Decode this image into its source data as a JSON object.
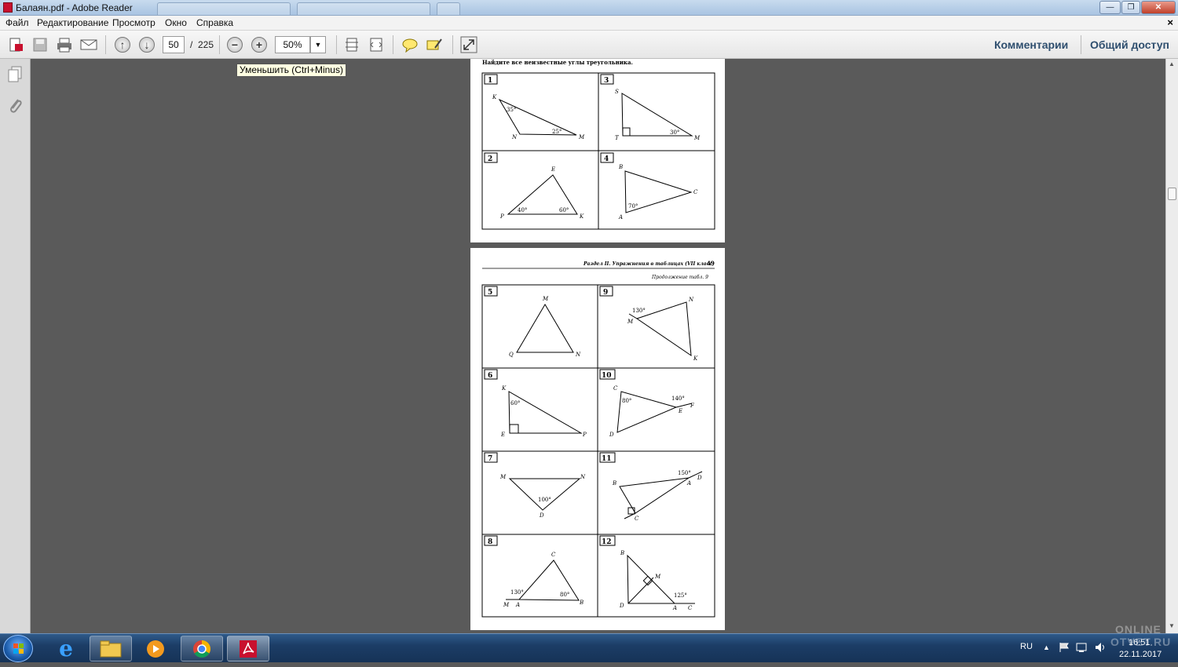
{
  "window": {
    "title": "Балаян.pdf - Adobe Reader",
    "minimize": "—",
    "maximize": "❐",
    "close": "✕"
  },
  "menu": {
    "items": [
      "Файл",
      "Редактирование",
      "Просмотр",
      "Окно",
      "Справка"
    ],
    "close": "×"
  },
  "toolbar": {
    "page_current": "50",
    "page_separator": "/",
    "page_total": "225",
    "zoom": "50%",
    "comments_label": "Комментарии",
    "share_label": "Общий доступ"
  },
  "tooltip": "Уменьшить (Ctrl+Minus)",
  "document": {
    "page1": {
      "header": "Найдите все неизвестные углы треугольника.",
      "cells": [
        {
          "num": "1",
          "labels": [
            "K",
            "N",
            "M",
            "35°",
            "25°"
          ]
        },
        {
          "num": "3",
          "labels": [
            "S",
            "T",
            "M",
            "30°"
          ]
        },
        {
          "num": "2",
          "labels": [
            "E",
            "P",
            "K",
            "40°",
            "60°"
          ]
        },
        {
          "num": "4",
          "labels": [
            "B",
            "C",
            "A",
            "70°"
          ]
        }
      ]
    },
    "page2": {
      "running_head": "Раздел II. Упражнения в таблицах (VII класс)",
      "page_number": "49",
      "continuation": "Продолжение табл. 9",
      "cells": [
        {
          "num": "5",
          "labels": [
            "M",
            "Q",
            "N"
          ]
        },
        {
          "num": "9",
          "labels": [
            "N",
            "M",
            "K",
            "130°"
          ]
        },
        {
          "num": "6",
          "labels": [
            "K",
            "E",
            "P",
            "60°"
          ]
        },
        {
          "num": "10",
          "labels": [
            "C",
            "D",
            "E",
            "F",
            "80°",
            "140°"
          ]
        },
        {
          "num": "7",
          "labels": [
            "M",
            "N",
            "D",
            "100°"
          ]
        },
        {
          "num": "11",
          "labels": [
            "B",
            "A",
            "D",
            "C",
            "150°"
          ]
        },
        {
          "num": "8",
          "labels": [
            "C",
            "M",
            "A",
            "B",
            "130°",
            "80°"
          ]
        },
        {
          "num": "12",
          "labels": [
            "B",
            "M",
            "D",
            "A",
            "C",
            "125°"
          ]
        }
      ]
    }
  },
  "taskbar": {
    "apps": [
      "internet-explorer",
      "file-explorer",
      "media-player",
      "chrome",
      "adobe-reader"
    ],
    "lang": "RU",
    "time": "16:51",
    "date": "22.11.2017"
  },
  "watermark": [
    "ONLINE",
    "OTVET.RU"
  ]
}
